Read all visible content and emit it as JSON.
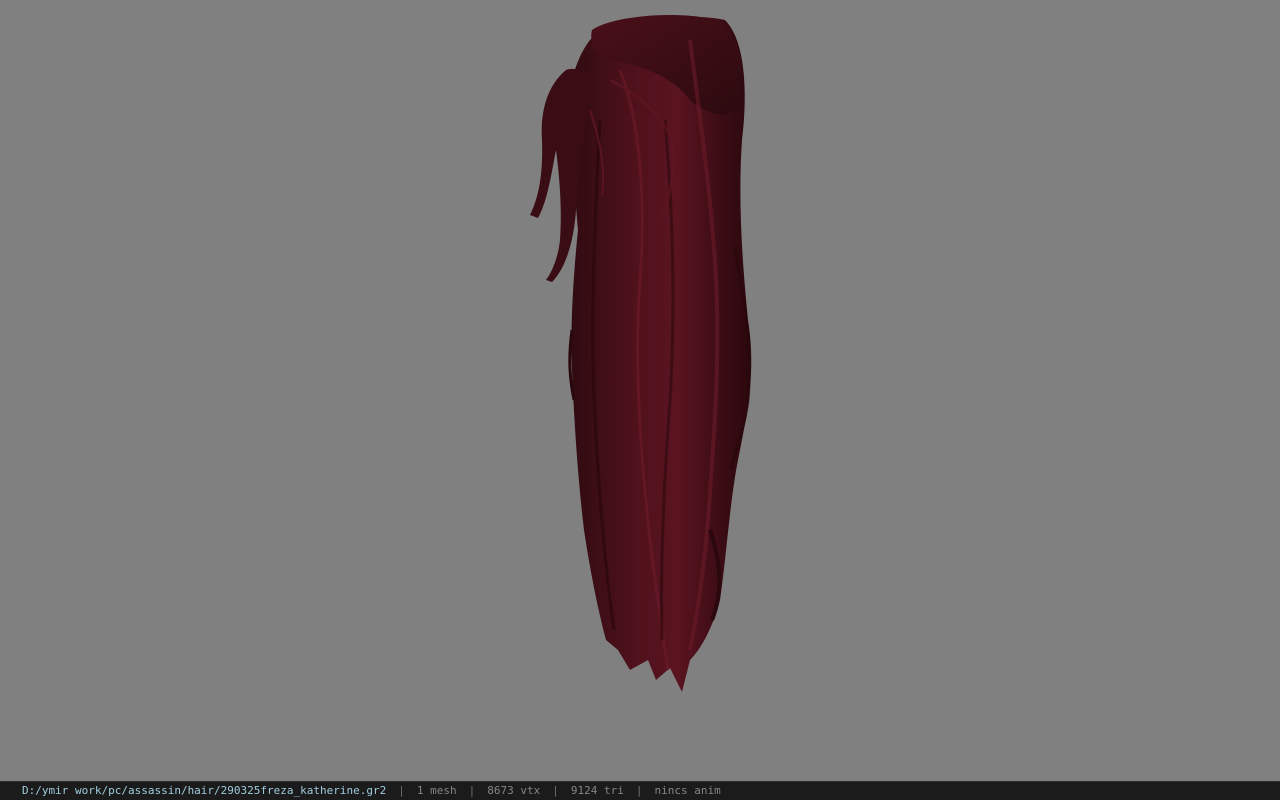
{
  "viewer": {
    "background_color": "#808080",
    "model": {
      "subject": "long dark red ponytail hair mesh",
      "hair_color": "#4a1019"
    }
  },
  "status_bar": {
    "file_path": "D:/ymir work/pc/assassin/hair/290325freza_katherine.gr2",
    "separator": "|",
    "mesh_count": "1 mesh",
    "vertex_count": "8673 vtx",
    "triangle_count": "9124 tri",
    "animation_status": "nincs anim",
    "path_color": "#9ecbdc",
    "bar_color": "#1b1b1b"
  }
}
